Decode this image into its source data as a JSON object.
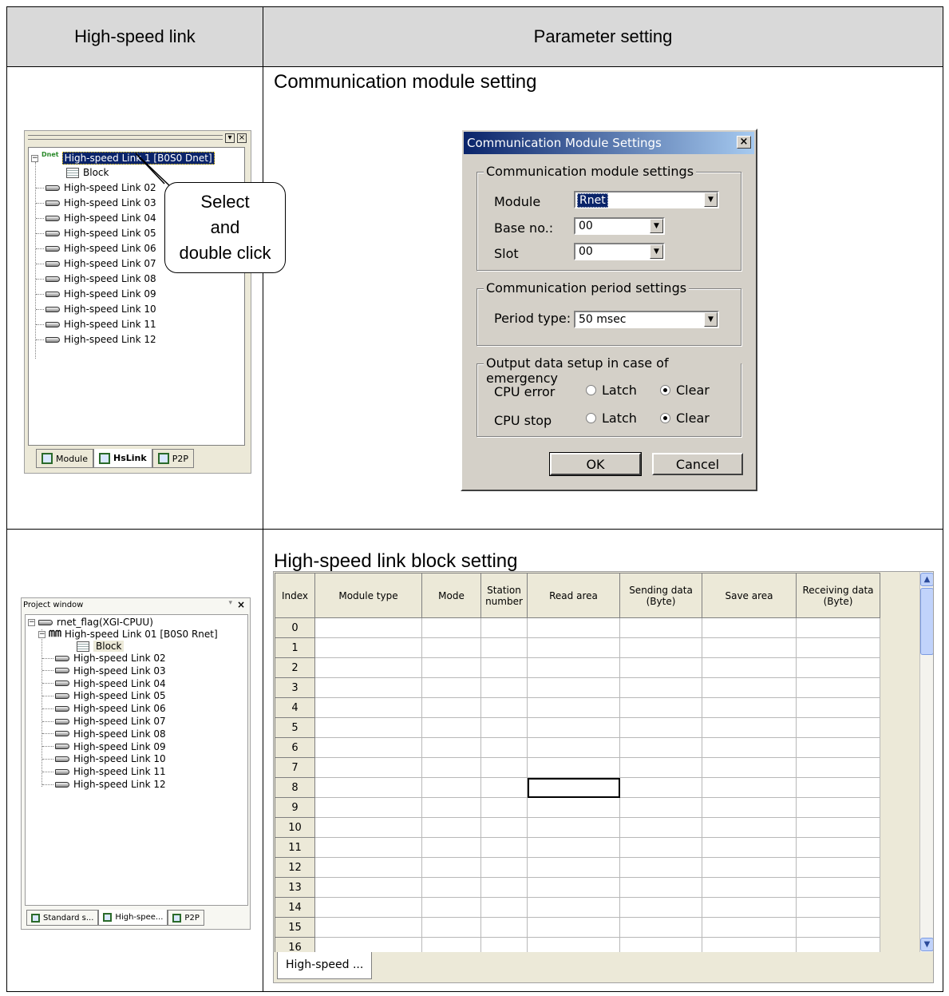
{
  "header": {
    "col1": "High-speed link",
    "col2": "Parameter setting"
  },
  "row1": {
    "section_title": "Communication module setting",
    "panel": {
      "tree": {
        "root_badge": "Dnet",
        "root_label": "High-speed Link 1 [B0S0 Dnet]",
        "block_label": "Block",
        "links": [
          "High-speed Link 02",
          "High-speed Link 03",
          "High-speed Link 04",
          "High-speed Link 05",
          "High-speed Link 06",
          "High-speed Link 07",
          "High-speed Link 08",
          "High-speed Link 09",
          "High-speed Link 10",
          "High-speed Link 11",
          "High-speed Link 12"
        ]
      },
      "tabs": [
        "Module",
        "HsLink",
        "P2P"
      ],
      "active_tab": "HsLink",
      "title_buttons": [
        "▾",
        "×"
      ]
    },
    "callout": {
      "line1": "Select",
      "line2": "and",
      "line3": "double click"
    },
    "dialog": {
      "title": "Communication Module Settings",
      "close_glyph": "×",
      "group1": {
        "label": "Communication module settings",
        "module_label": "Module",
        "module_value": "Rnet",
        "base_label": "Base no.:",
        "base_value": "00",
        "slot_label": "Slot",
        "slot_value": "00"
      },
      "group2": {
        "label": "Communication period settings",
        "period_label": "Period type:",
        "period_value": "50 msec"
      },
      "group3": {
        "label": "Output data setup in case of emergency",
        "cpu_error_label": "CPU error",
        "cpu_stop_label": "CPU stop",
        "latch_label": "Latch",
        "clear_label": "Clear",
        "cpu_error_selected": "Clear",
        "cpu_stop_selected": "Clear"
      },
      "ok_label": "OK",
      "cancel_label": "Cancel"
    }
  },
  "row2": {
    "section_title": "High-speed link block setting",
    "panel": {
      "title": "Project window",
      "pin_glyph": "▾",
      "close_glyph": "×",
      "project_label": "rnet_flag(XGI-CPUU)",
      "root_label": "High-speed Link 01 [B0S0 Rnet]",
      "block_label": "Block",
      "links": [
        "High-speed Link 02",
        "High-speed Link 03",
        "High-speed Link 04",
        "High-speed Link 05",
        "High-speed Link 06",
        "High-speed Link 07",
        "High-speed Link 08",
        "High-speed Link 09",
        "High-speed Link 10",
        "High-speed Link 11",
        "High-speed Link 12"
      ],
      "tabs": [
        "Standard s...",
        "High-spee...",
        "P2P"
      ]
    },
    "grid": {
      "columns": [
        "Index",
        "Module type",
        "Mode",
        "Station number",
        "Read area",
        "Sending data (Byte)",
        "Save area",
        "Receiving data (Byte)"
      ],
      "rows": [
        "0",
        "1",
        "2",
        "3",
        "4",
        "5",
        "6",
        "7",
        "8",
        "9",
        "10",
        "11",
        "12",
        "13",
        "14",
        "15",
        "16"
      ],
      "selected_cell": {
        "row": "8",
        "column": "Read area"
      },
      "tab_label": "High-speed ..."
    }
  },
  "colors": {
    "header_bg": "#d9d9d9",
    "dialog_title": "#0a246a",
    "selection": "#0a246a",
    "window_bg": "#ece9d8"
  }
}
